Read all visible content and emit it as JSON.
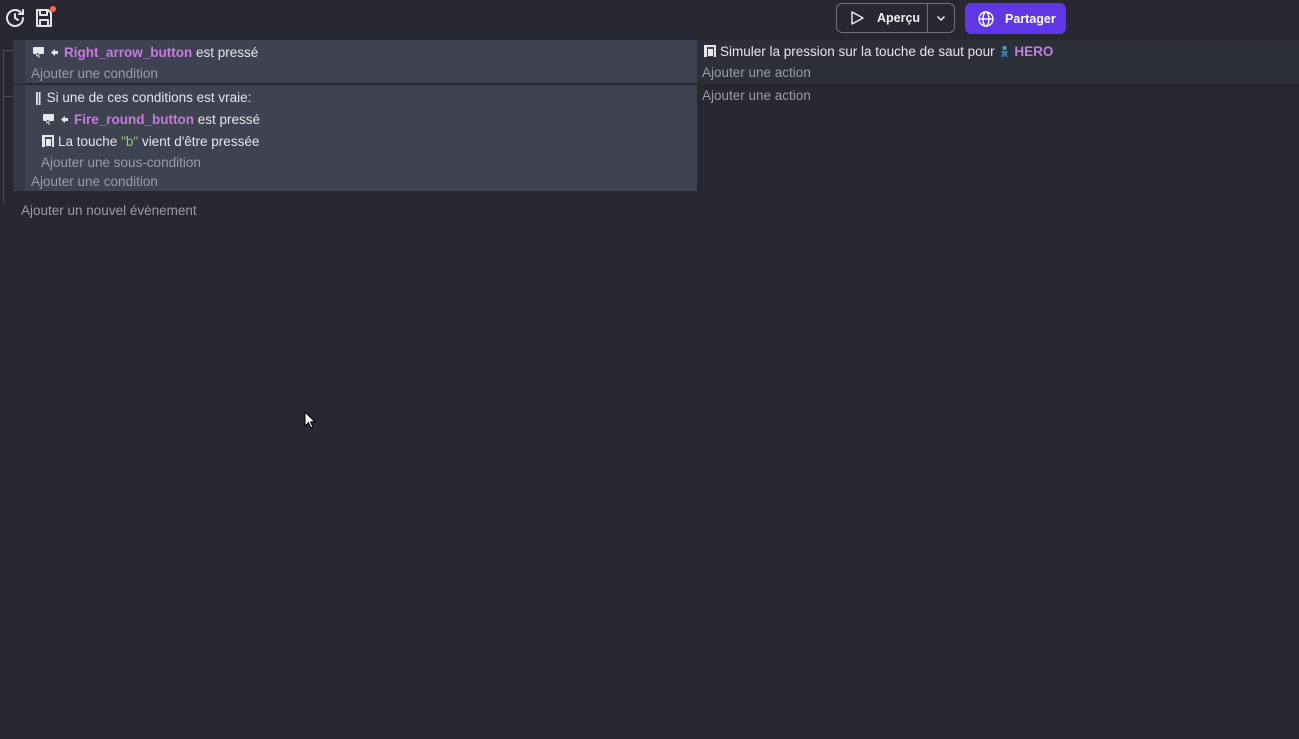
{
  "toolbar": {
    "preview_label": "Aperçu",
    "share_label": "Partager",
    "save_has_unsaved": true
  },
  "events": {
    "event1": {
      "condition": {
        "object": "Right_arrow_button",
        "suffix": "est pressé"
      },
      "add_condition": "Ajouter une condition",
      "action": {
        "text": "Simuler la pression sur la touche de saut pour",
        "object": "HERO"
      },
      "add_action": "Ajouter une action"
    },
    "event2": {
      "or_header": "Si une de ces conditions est vraie:",
      "sub1": {
        "object": "Fire_round_button",
        "suffix": "est pressé"
      },
      "sub2": {
        "prefix": "La touche",
        "key": "\"b\"",
        "suffix": "vient d'être pressée"
      },
      "add_subcondition": "Ajouter une sous-condition",
      "add_condition": "Ajouter une condition",
      "add_action": "Ajouter une action"
    },
    "add_new_event": "Ajouter un nouvel évènement"
  },
  "colors": {
    "background": "#272832",
    "event_block": "#3f4351",
    "object_name": "#c47ce0",
    "string_value": "#93c96a",
    "share_button": "#6136e6",
    "unsaved_dot": "#ff6b4a"
  },
  "icons": [
    "history-icon",
    "save-icon",
    "play-icon",
    "chevron-down-icon",
    "globe-icon",
    "button-object-icon",
    "arrow-left-icon",
    "keyboard-key-icon",
    "hero-sprite-icon",
    "mouse-cursor-icon"
  ]
}
